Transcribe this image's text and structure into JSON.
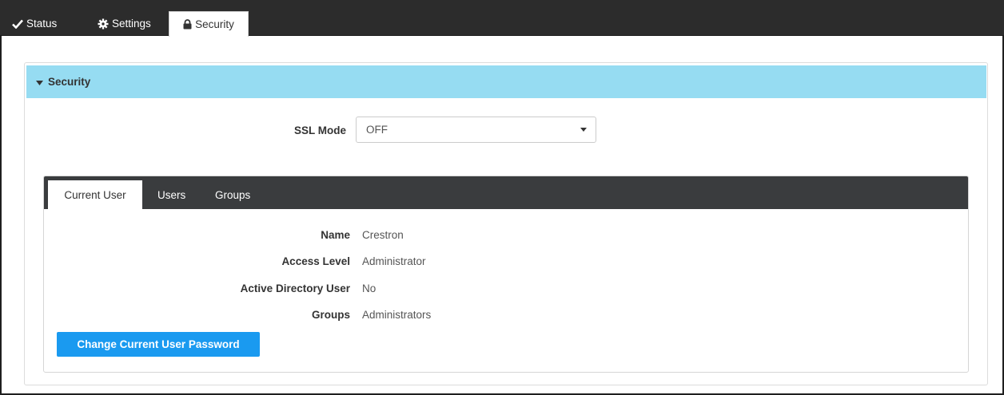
{
  "top_tabs": [
    {
      "label": "Status",
      "icon": "check-icon"
    },
    {
      "label": "Settings",
      "icon": "gear-icon"
    },
    {
      "label": "Security",
      "icon": "lock-icon",
      "active": true
    }
  ],
  "security_panel": {
    "title": "Security",
    "ssl_mode": {
      "label": "SSL Mode",
      "value": "OFF"
    }
  },
  "user_tabs": [
    {
      "label": "Current User",
      "active": true
    },
    {
      "label": "Users"
    },
    {
      "label": "Groups"
    }
  ],
  "current_user": {
    "rows": [
      {
        "label": "Name",
        "value": "Crestron"
      },
      {
        "label": "Access Level",
        "value": "Administrator"
      },
      {
        "label": "Active Directory User",
        "value": "No"
      },
      {
        "label": "Groups",
        "value": "Administrators"
      }
    ],
    "change_password_label": "Change Current User Password"
  },
  "colors": {
    "topbar": "#2c2c2c",
    "panel_header": "#96dcf2",
    "primary_button": "#1a9af0",
    "inner_tabbar": "#3a3c3e"
  }
}
